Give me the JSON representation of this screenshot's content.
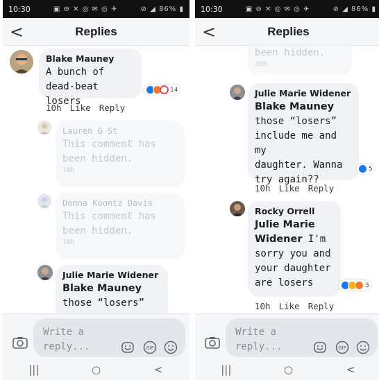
{
  "screens": [
    {
      "status": {
        "time": "10:30",
        "icons": "▣ ⊖ ✕ ◎ ✉ ◎ ✈",
        "signal": "⊘ ◢ 86% ▮"
      },
      "header": {
        "back": "<",
        "title": "Replies"
      },
      "comments": [
        {
          "author": "Blake Mauney",
          "lines": [
            "A bunch of",
            "dead-beat losers"
          ],
          "time": "10h",
          "like": "Like",
          "reply": "Reply",
          "reactions": {
            "kinds": [
              "like",
              "angry",
              "love"
            ],
            "count": "14"
          }
        },
        {
          "author": "Lauren G St",
          "lines": [
            "This comment has",
            "been hidden."
          ],
          "time": "10h",
          "hidden": true
        },
        {
          "author": "Donna Koontz Davis",
          "lines": [
            "This comment has",
            "been hidden."
          ],
          "time": "10h",
          "hidden": true
        },
        {
          "author": "Julie Marie Widener",
          "mention": "Blake Mauney",
          "lines": [
            "those “losers”"
          ]
        }
      ],
      "composer": {
        "placeholder_1": "Write a",
        "placeholder_2": "reply..."
      },
      "nav": {
        "recents": "|||",
        "home": "○",
        "back": "<"
      }
    },
    {
      "status": {
        "time": "10:30",
        "icons": "▣ ⊖ ✕ ◎ ✉ ◎ ✈",
        "signal": "⊘ ◢ 86% ▮"
      },
      "header": {
        "back": "<",
        "title": "Replies"
      },
      "top_fragment": {
        "line": "been hidden.",
        "time": "10h"
      },
      "comments": [
        {
          "author": "Julie Marie Widener",
          "mention": "Blake Mauney",
          "lines": [
            "those “losers”",
            "include me and my",
            "daughter. Wanna",
            "try again??"
          ],
          "time": "10h",
          "like": "Like",
          "reply": "Reply",
          "reactions": {
            "kinds": [
              "like"
            ],
            "count": "5"
          }
        },
        {
          "author": "Rocky Orrell",
          "mention_1": "Julie Marie",
          "mention_2": "Widener",
          "mention_tail": " I'm",
          "lines": [
            "sorry you and",
            "your daughter",
            "are losers"
          ],
          "time": "10h",
          "like": "Like",
          "reply": "Reply",
          "reactions": {
            "kinds": [
              "like",
              "haha",
              "angry"
            ],
            "count": "3"
          }
        }
      ],
      "composer": {
        "placeholder_1": "Write a",
        "placeholder_2": "reply..."
      },
      "nav": {
        "recents": "|||",
        "home": "○",
        "back": "<"
      }
    }
  ]
}
